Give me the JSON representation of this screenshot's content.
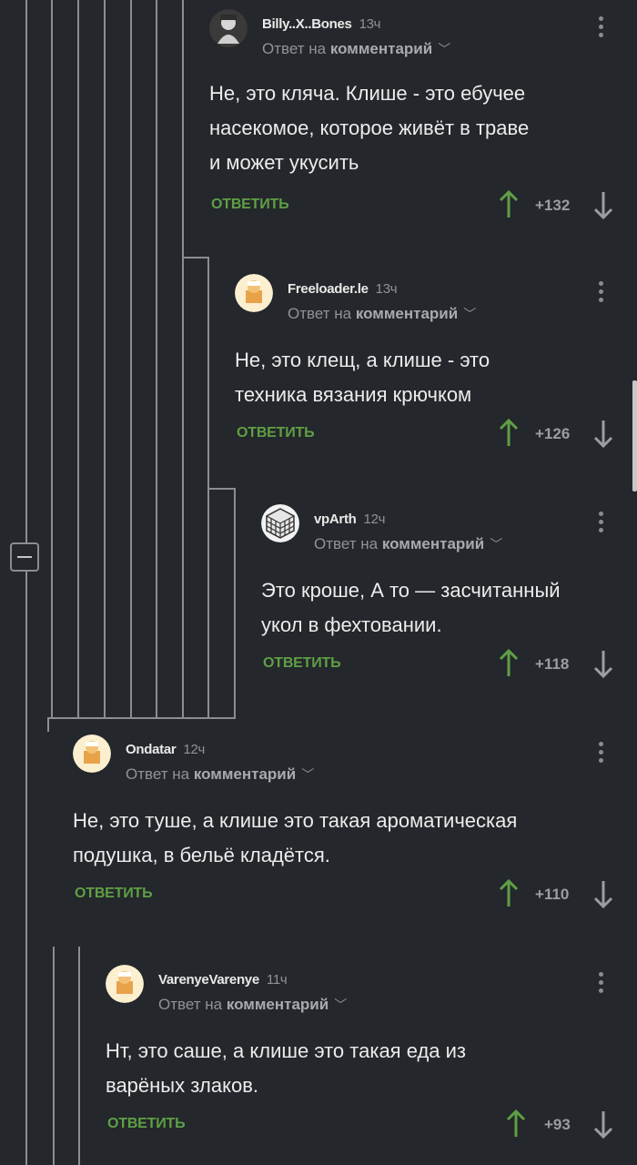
{
  "colors": {
    "accent": "#5f9f45",
    "background": "#24272b",
    "muted": "#8f9296"
  },
  "comments": [
    {
      "author": "Billy..X..Bones",
      "time": "13ч",
      "reply_prefix": "Ответ на",
      "reply_target": "комментарий",
      "text_lines": [
        "Не, это кляча. Клише - это ебучее",
        "насекомое, которое живёт в траве",
        "и может укусить"
      ],
      "reply_label": "ОТВЕТИТЬ",
      "score": "+132",
      "avatar": "photo-avatar"
    },
    {
      "author": "Freeloader.le",
      "time": "13ч",
      "reply_prefix": "Ответ на",
      "reply_target": "комментарий",
      "text_lines": [
        "Не, это клещ, а клише - это",
        "техника вязания крючком"
      ],
      "reply_label": "ОТВЕТИТЬ",
      "score": "+126",
      "avatar": "default-avatar"
    },
    {
      "author": "vpArth",
      "time": "12ч",
      "reply_prefix": "Ответ на",
      "reply_target": "комментарий",
      "text_lines": [
        "Это кроше, А то — засчитанный",
        "укол в фехтовании."
      ],
      "reply_label": "ОТВЕТИТЬ",
      "score": "+118",
      "avatar": "cube-avatar"
    },
    {
      "author": "Ondatar",
      "time": "12ч",
      "reply_prefix": "Ответ на",
      "reply_target": "комментарий",
      "text_lines": [
        "Не, это туше, а клише это такая ароматическая",
        "подушка, в бельё кладётся."
      ],
      "reply_label": "ОТВЕТИТЬ",
      "score": "+110",
      "avatar": "default-avatar"
    },
    {
      "author": "VarenyeVarenye",
      "time": "11ч",
      "reply_prefix": "Ответ на",
      "reply_target": "комментарий",
      "text_lines": [
        "Нт, это саше, а клише это такая еда из",
        "варёных злаков."
      ],
      "reply_label": "ОТВЕТИТЬ",
      "score": "+93",
      "avatar": "default-avatar"
    }
  ]
}
